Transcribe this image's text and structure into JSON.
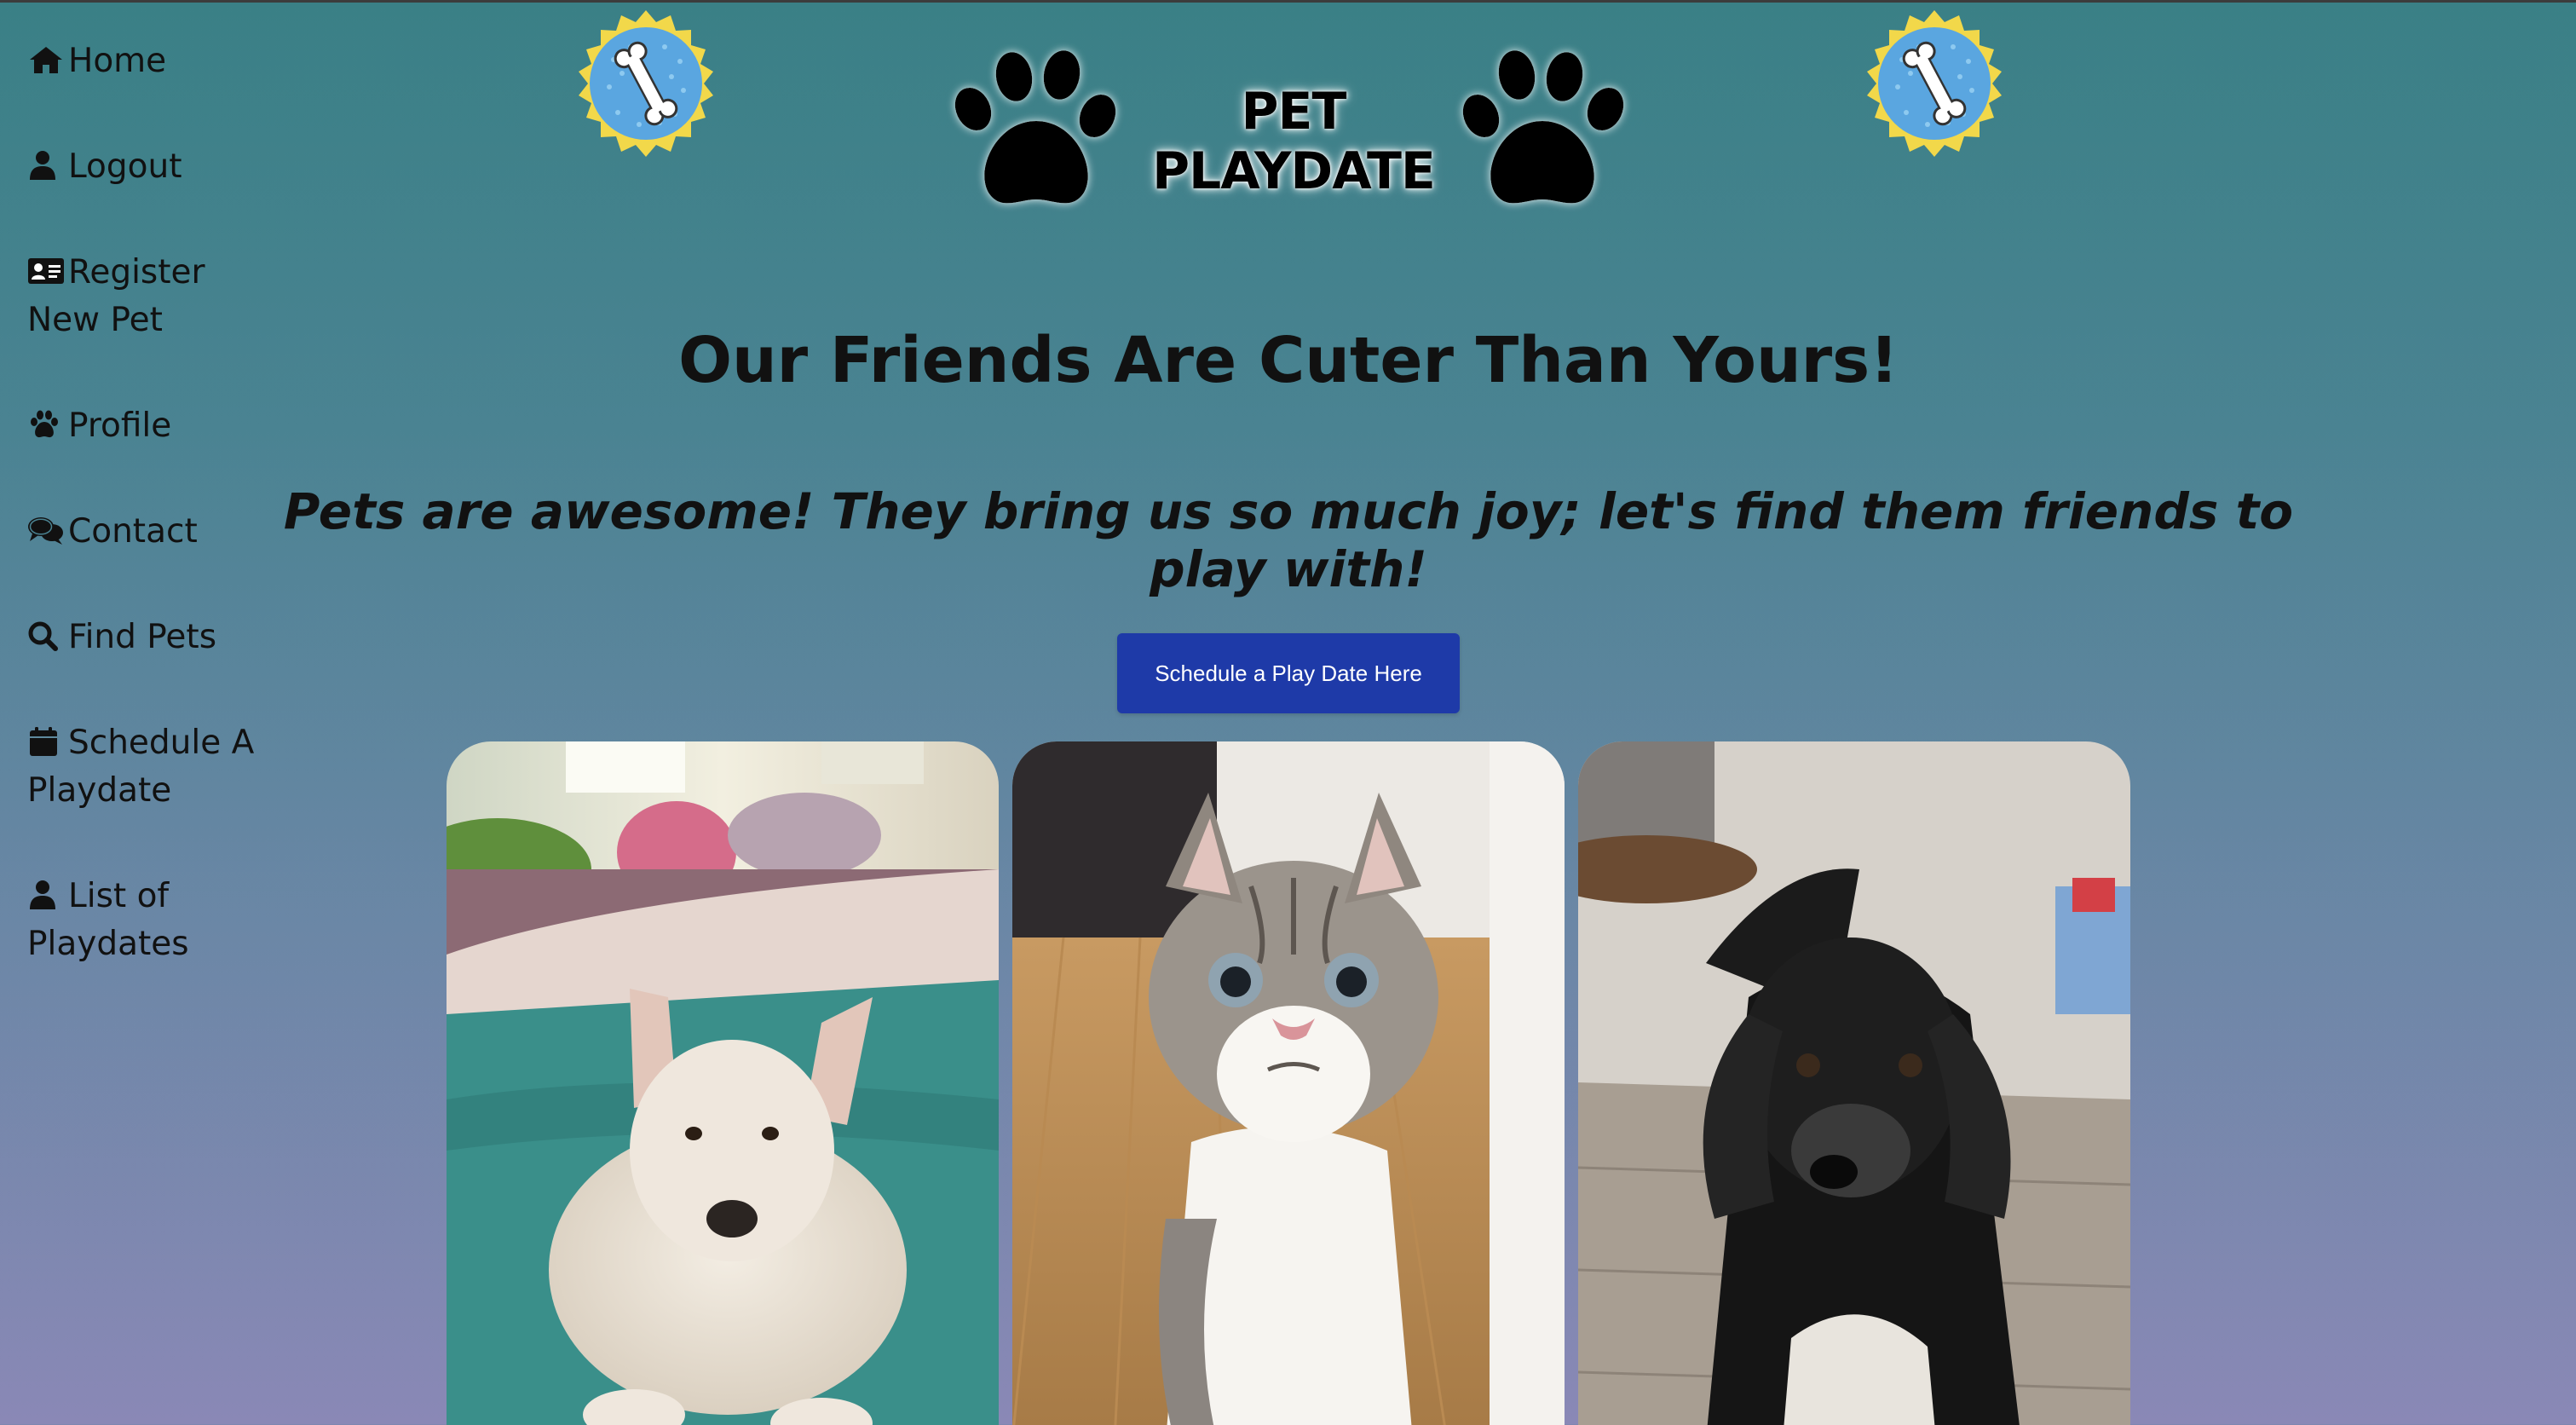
{
  "nav": {
    "items": [
      {
        "label": "Home",
        "icon": "home-icon"
      },
      {
        "label": "Logout",
        "icon": "user-icon"
      },
      {
        "label": "Register New Pet",
        "icon": "id-card-icon"
      },
      {
        "label": "Profile",
        "icon": "paw-icon"
      },
      {
        "label": "Contact",
        "icon": "comments-icon"
      },
      {
        "label": "Find Pets",
        "icon": "search-icon"
      },
      {
        "label": "Schedule A Playdate",
        "icon": "calendar-icon"
      },
      {
        "label": "List of Playdates",
        "icon": "user-icon"
      }
    ]
  },
  "header": {
    "logo_text": "PET PLAYDATE",
    "badge_icon": "bone-badge-icon",
    "colors": {
      "badge_ring": "#f2d84a",
      "badge_fill": "#5aa6e0",
      "paw": "#000000"
    }
  },
  "main": {
    "title": "Our Friends Are Cuter Than Yours!",
    "tagline": "Pets are awesome! They bring us so much joy; let's find them friends to play with!",
    "cta_label": "Schedule a Play Date Here",
    "photos": [
      {
        "subject": "white-dog-photo"
      },
      {
        "subject": "tabby-cat-photo"
      },
      {
        "subject": "black-dog-photo"
      }
    ]
  },
  "theme": {
    "background_top": "#3a8086",
    "background_bottom": "#8a88b6",
    "button_color": "#1e3aa8",
    "text_color": "#111111"
  }
}
